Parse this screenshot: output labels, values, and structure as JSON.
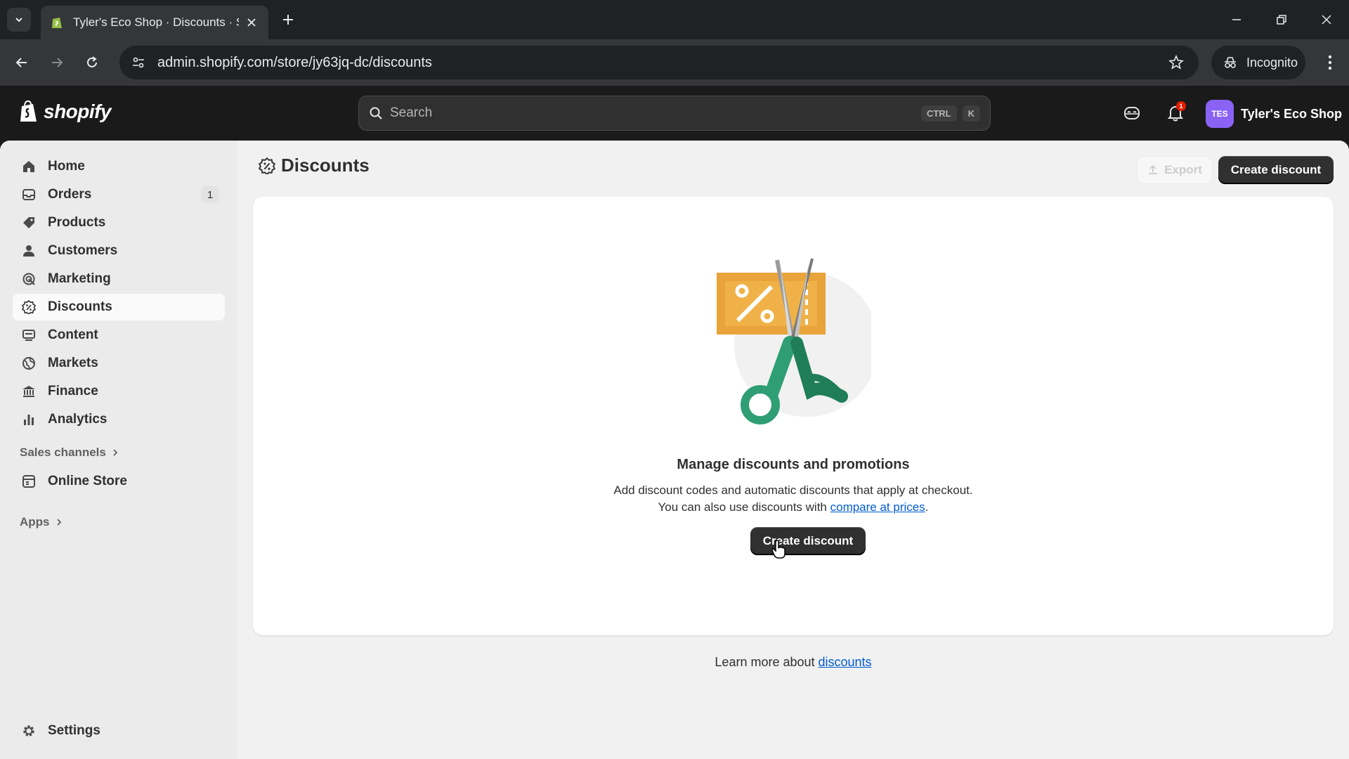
{
  "browser": {
    "tab_title": "Tyler's Eco Shop · Discounts · Sh",
    "url": "admin.shopify.com/store/jy63jq-dc/discounts",
    "incognito_label": "Incognito"
  },
  "topbar": {
    "logo_text": "shopify",
    "search_placeholder": "Search",
    "shortcut_keys": [
      "CTRL",
      "K"
    ],
    "notification_count": "1",
    "store_initials": "TES",
    "store_name": "Tyler's Eco Shop"
  },
  "sidebar": {
    "items": [
      {
        "label": "Home",
        "icon": "home-icon"
      },
      {
        "label": "Orders",
        "icon": "inbox-icon",
        "count": "1"
      },
      {
        "label": "Products",
        "icon": "tag-icon"
      },
      {
        "label": "Customers",
        "icon": "person-icon"
      },
      {
        "label": "Marketing",
        "icon": "target-icon"
      },
      {
        "label": "Discounts",
        "icon": "discount-icon",
        "active": true
      },
      {
        "label": "Content",
        "icon": "content-icon"
      },
      {
        "label": "Markets",
        "icon": "globe-icon"
      },
      {
        "label": "Finance",
        "icon": "bank-icon"
      },
      {
        "label": "Analytics",
        "icon": "bar-chart-icon"
      }
    ],
    "sales_channels_label": "Sales channels",
    "online_store_label": "Online Store",
    "apps_label": "Apps",
    "settings_label": "Settings"
  },
  "page": {
    "title": "Discounts",
    "export_label": "Export",
    "create_label": "Create discount"
  },
  "empty_state": {
    "heading": "Manage discounts and promotions",
    "line1": "Add discount codes and automatic discounts that apply at checkout.",
    "line2_prefix": "You can also use discounts with ",
    "line2_link": "compare at prices",
    "line2_suffix": ".",
    "button_label": "Create discount"
  },
  "footer": {
    "prefix": "Learn more about ",
    "link": "discounts"
  },
  "colors": {
    "accent": "#303030",
    "link": "#005bd3",
    "coupon": "#e8a33b",
    "scissors": "#2f9e74"
  }
}
